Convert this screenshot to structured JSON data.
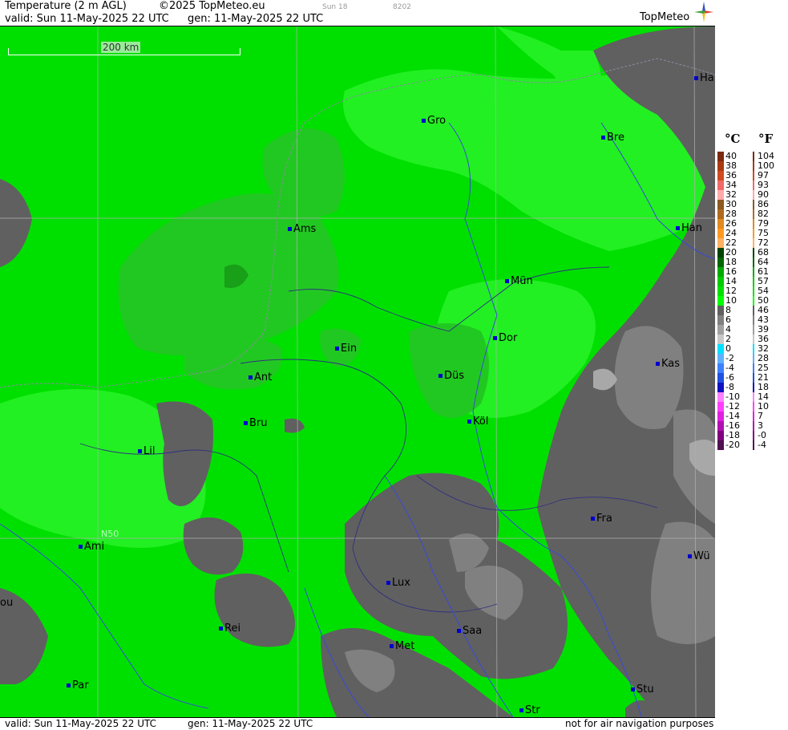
{
  "header": {
    "title": "Temperature (2 m AGL)",
    "copyright": "©2025 TopMeteo.eu",
    "small_1": "Sun 18",
    "small_2": "8202",
    "valid": "valid:  Sun  11-May-2025  22 UTC",
    "gen": "gen: 11-May-2025  22 UTC",
    "logo": "TopMeteo"
  },
  "footer": {
    "valid": "valid:  Sun  11-May-2025  22 UTC",
    "gen": "gen: 11-May-2025  22 UTC",
    "notice": "not for air navigation purposes"
  },
  "map": {
    "scale_label": "200 km",
    "latitude_label": "N50",
    "cities": [
      "Ha",
      "Gro",
      "Bre",
      "Ams",
      "Han",
      "Mün",
      "Ein",
      "Dor",
      "Kas",
      "Ant",
      "Düs",
      "Bru",
      "Köl",
      "Lil",
      "Fra",
      "Ami",
      "Wü",
      "Lux",
      "ou",
      "Rei",
      "Saa",
      "Met",
      "Par",
      "Stu",
      "Str"
    ],
    "colors": {
      "green_main": "#00e000",
      "green_light": "#22f022",
      "green_mid": "#22c822",
      "green_dark": "#18a018",
      "grey_dark": "#606060",
      "grey_mid": "#808080",
      "grey_light": "#a8a8a8",
      "rivers": "#3a4ad8",
      "borders": "#4a4a6a"
    }
  },
  "legend": {
    "unit_c": "°C",
    "unit_f": "°F",
    "celsius": [
      "40",
      "38",
      "36",
      "34",
      "32",
      "30",
      "28",
      "26",
      "24",
      "22",
      "20",
      "18",
      "16",
      "14",
      "12",
      "10",
      "8",
      "6",
      "4",
      "2",
      "0",
      "-2",
      "-4",
      "-6",
      "-8",
      "-10",
      "-12",
      "-14",
      "-16",
      "-18",
      "-20"
    ],
    "fahrenheit": [
      "104",
      "100",
      "97",
      "93",
      "90",
      "86",
      "82",
      "79",
      "75",
      "72",
      "68",
      "64",
      "61",
      "57",
      "54",
      "50",
      "46",
      "43",
      "39",
      "36",
      "32",
      "28",
      "25",
      "21",
      "18",
      "14",
      "10",
      "7",
      "3",
      "-0",
      "-4"
    ],
    "swatches": [
      "#7a2a10",
      "#aa3a10",
      "#d04a20",
      "#f06a6a",
      "#ffaaaa",
      "#8a5a20",
      "#b06a20",
      "#e08a20",
      "#ff9a20",
      "#ffb060",
      "#004400",
      "#006600",
      "#00aa00",
      "#00cc00",
      "#00e000",
      "#00ff00",
      "#606060",
      "#808080",
      "#a0a0a0",
      "#c8c8c8",
      "#00e0ff",
      "#60b0ff",
      "#4080ff",
      "#2050e0",
      "#1010c0",
      "#ff80ff",
      "#ff40ff",
      "#e020e0",
      "#b010b0",
      "#800080",
      "#501050"
    ]
  }
}
